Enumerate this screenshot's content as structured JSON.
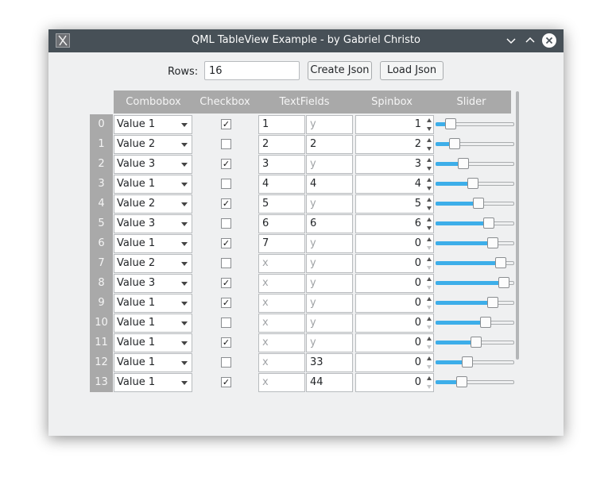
{
  "window": {
    "title": "QML TableView Example - by Gabriel Christo",
    "icons": {
      "app": "app-logo-icon",
      "minimize": "chevron-down-icon",
      "maximize": "chevron-up-icon",
      "close": "close-icon"
    }
  },
  "toolbar": {
    "rows_label": "Rows:",
    "rows_value": "16",
    "create_json_label": "Create Json",
    "load_json_label": "Load Json"
  },
  "headers": [
    "Combobox",
    "Checkbox",
    "TextFields",
    "Spinbox",
    "Slider"
  ],
  "colors": {
    "header_bg": "#a9a9a9",
    "accent": "#3daee9",
    "titlebar": "#475057"
  },
  "rows": [
    {
      "num": "0",
      "combo": "Value 1",
      "checked": true,
      "t1": "1",
      "t2": "y",
      "spin": "1",
      "slider": 0.14
    },
    {
      "num": "1",
      "combo": "Value 2",
      "checked": false,
      "t1": "2",
      "t2": "2",
      "spin": "2",
      "slider": 0.2
    },
    {
      "num": "2",
      "combo": "Value 3",
      "checked": true,
      "t1": "3",
      "t2": "y",
      "spin": "3",
      "slider": 0.33
    },
    {
      "num": "3",
      "combo": "Value 1",
      "checked": false,
      "t1": "4",
      "t2": "4",
      "spin": "4",
      "slider": 0.47
    },
    {
      "num": "4",
      "combo": "Value 2",
      "checked": true,
      "t1": "5",
      "t2": "y",
      "spin": "5",
      "slider": 0.55
    },
    {
      "num": "5",
      "combo": "Value 3",
      "checked": false,
      "t1": "6",
      "t2": "6",
      "spin": "6",
      "slider": 0.71
    },
    {
      "num": "6",
      "combo": "Value 1",
      "checked": true,
      "t1": "7",
      "t2": "y",
      "spin": "0",
      "slider": 0.77
    },
    {
      "num": "7",
      "combo": "Value 2",
      "checked": false,
      "t1": "x",
      "t2": "y",
      "spin": "0",
      "slider": 0.88
    },
    {
      "num": "8",
      "combo": "Value 3",
      "checked": true,
      "t1": "x",
      "t2": "y",
      "spin": "0",
      "slider": 0.93
    },
    {
      "num": "9",
      "combo": "Value 1",
      "checked": true,
      "t1": "x",
      "t2": "y",
      "spin": "0",
      "slider": 0.77
    },
    {
      "num": "10",
      "combo": "Value 1",
      "checked": false,
      "t1": "x",
      "t2": "y",
      "spin": "0",
      "slider": 0.66
    },
    {
      "num": "11",
      "combo": "Value 1",
      "checked": true,
      "t1": "x",
      "t2": "y",
      "spin": "0",
      "slider": 0.52
    },
    {
      "num": "12",
      "combo": "Value 1",
      "checked": false,
      "t1": "x",
      "t2": "33",
      "spin": "0",
      "slider": 0.39
    },
    {
      "num": "13",
      "combo": "Value 1",
      "checked": true,
      "t1": "x",
      "t2": "44",
      "spin": "0",
      "slider": 0.3
    }
  ]
}
